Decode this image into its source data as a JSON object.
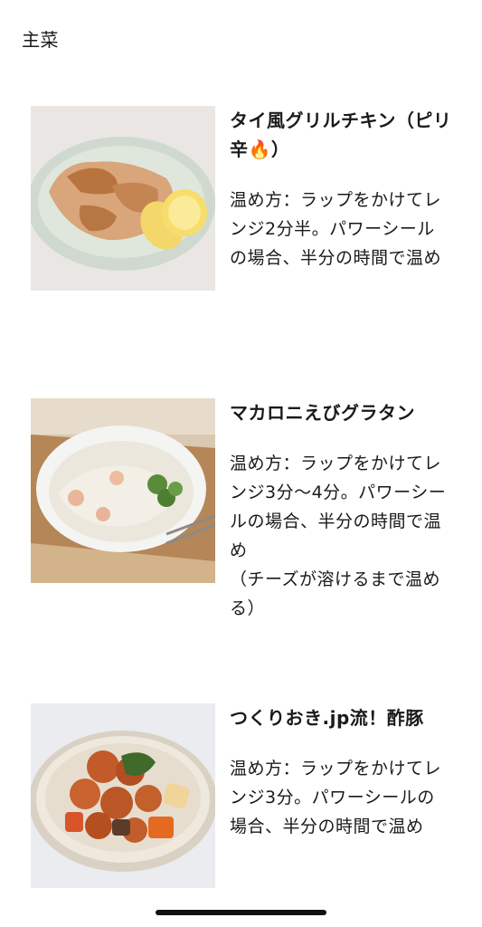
{
  "section": {
    "title": "主菜"
  },
  "recipes": [
    {
      "name": "タイ風グリルチキン（ピリ辛🔥）",
      "photo_icon": "grilled-chicken-photo",
      "description": "温め方：ラップをかけてレンジ2分半。パワーシールの場合、半分の時間で温め"
    },
    {
      "name": "マカロニえびグラタン",
      "photo_icon": "shrimp-gratin-photo",
      "description": "温め方：ラップをかけてレンジ3分〜4分。パワーシールの場合、半分の時間で温め\n（チーズが溶けるまで温める）"
    },
    {
      "name": "つくりおき.jp流！酢豚",
      "photo_icon": "sweet-sour-pork-photo",
      "description": "温め方：ラップをかけてレンジ3分。パワーシールの場合、半分の時間で温め"
    }
  ]
}
